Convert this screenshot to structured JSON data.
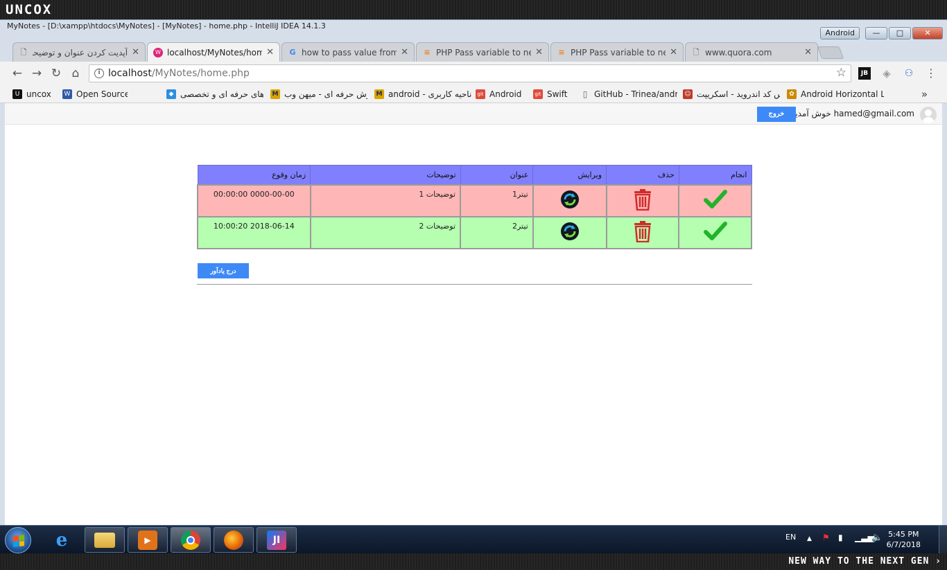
{
  "brand": {
    "logo": "UNCOX",
    "slogan": "NEW WAY TO THE NEXT GEN ›"
  },
  "window": {
    "title": "MyNotes - [D:\\xampp\\htdocs\\MyNotes] - [MyNotes] - home.php - IntelliJ IDEA 14.1.3",
    "profile_label": "Android",
    "minimize": "—",
    "maximize": "□",
    "close": "✕"
  },
  "tabs": [
    {
      "label": "آپدیت کردن عنوان و توضیحات با",
      "favicon": "page-icon",
      "active": false
    },
    {
      "label": "localhost/MyNotes/home.php",
      "favicon": "wamp-icon",
      "active": true
    },
    {
      "label": "how to pass value from one",
      "favicon": "google-icon",
      "active": false
    },
    {
      "label": "PHP Pass variable to next pa",
      "favicon": "stackoverflow-icon",
      "active": false
    },
    {
      "label": "PHP Pass variable to next pa",
      "favicon": "stackoverflow-icon",
      "active": false
    },
    {
      "label": "www.quora.com",
      "favicon": "page-icon",
      "active": false
    }
  ],
  "tab_close": "✕",
  "toolbar": {
    "back": "←",
    "forward": "→",
    "reload": "↻",
    "home": "⌂",
    "url_host": "localhost",
    "url_path": "/MyNotes/home.php",
    "star": "☆",
    "menu": "⋮"
  },
  "bookmarks": [
    {
      "label": "uncox",
      "icon_text": "U",
      "color": "#111111"
    },
    {
      "label": "Open Source",
      "icon_text": "W",
      "color": "#2f5aa8"
    },
    {
      "label": "پروژه های حرفه ای و تخصصی",
      "icon_text": "◆",
      "color": "#2b8fe0"
    },
    {
      "label": "آموزش حرفه ای - میهن وب",
      "icon_text": "M",
      "color": "#d9a300"
    },
    {
      "label": "ناحیه کاربری - android",
      "icon_text": "M",
      "color": "#d9a300"
    },
    {
      "label": "Android",
      "icon_text": "git",
      "color": "#e04a3a"
    },
    {
      "label": "Swift",
      "icon_text": "git",
      "color": "#e04a3a"
    },
    {
      "label": "GitHub - Trinea/andr",
      "icon_text": "▯",
      "color": "#888888"
    },
    {
      "label": "سورس کد اندروید - اسکریپت",
      "icon_text": "☺",
      "color": "#c0392b"
    },
    {
      "label": "Android Horizontal L",
      "icon_text": "✿",
      "color": "#c98a00"
    }
  ],
  "bookmarks_more": "»",
  "page": {
    "welcome": "hamed@gmail.com خوش آمدید",
    "logout": "خروج",
    "table": {
      "headers": [
        "انجام",
        "حذف",
        "ویرایش",
        "عنوان",
        "توضیحات",
        "زمان وقوع"
      ],
      "rows": [
        {
          "status": "pending",
          "title": "تیتر1",
          "description": "توضیحات 1",
          "time": "0000-00-00 00:00:00"
        },
        {
          "status": "done",
          "title": "تیتر2",
          "description": "توضیحات 2",
          "time": "2018-06-14 10:00:20"
        }
      ]
    },
    "add_button": "درج یادآور"
  },
  "taskbar": {
    "language": "EN",
    "time": "5:45 PM",
    "date": "6/7/2018"
  },
  "colors": {
    "header": "#8080ff",
    "row_pending": "#ffb6b6",
    "row_done": "#b6ffb0",
    "button": "#3d8af7",
    "check": "#22b32a",
    "trash": "#d02b2b"
  }
}
